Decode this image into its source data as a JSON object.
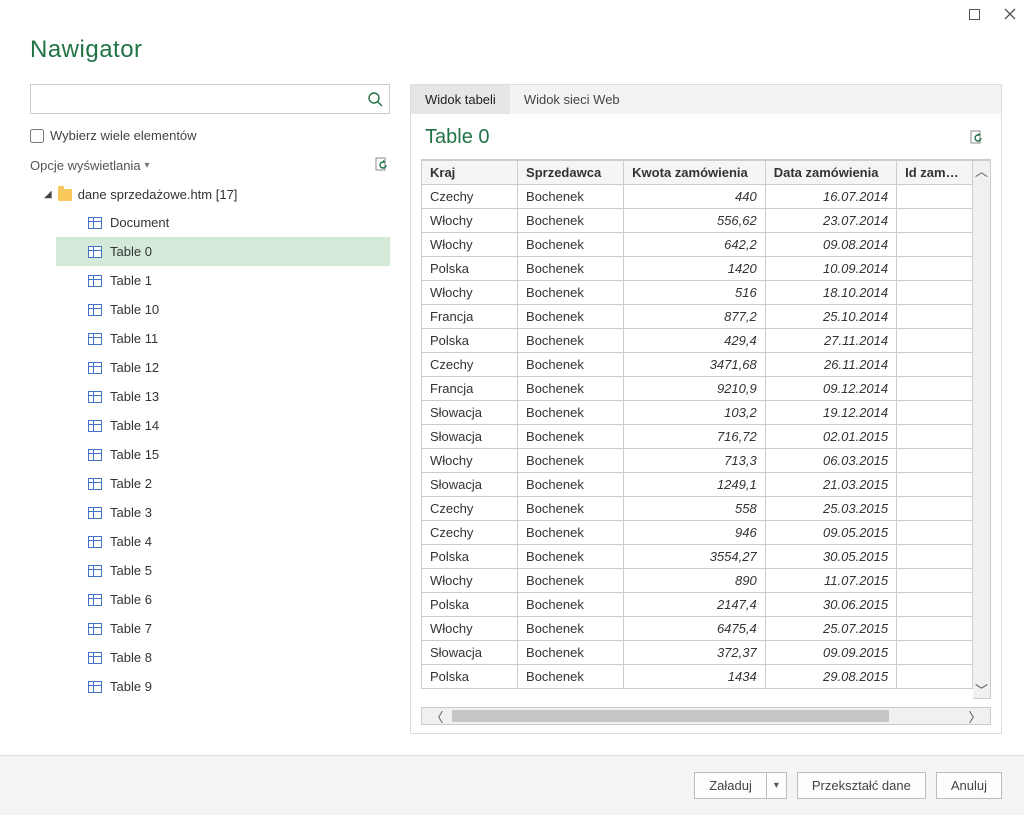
{
  "window": {
    "title": "Nawigator"
  },
  "left": {
    "search_placeholder": "",
    "multi_select_label": "Wybierz wiele elementów",
    "display_options_label": "Opcje wyświetlania",
    "root_label": "dane sprzedażowe.htm [17]",
    "items": [
      {
        "label": "Document",
        "selected": false
      },
      {
        "label": "Table 0",
        "selected": true
      },
      {
        "label": "Table 1",
        "selected": false
      },
      {
        "label": "Table 10",
        "selected": false
      },
      {
        "label": "Table 11",
        "selected": false
      },
      {
        "label": "Table 12",
        "selected": false
      },
      {
        "label": "Table 13",
        "selected": false
      },
      {
        "label": "Table 14",
        "selected": false
      },
      {
        "label": "Table 15",
        "selected": false
      },
      {
        "label": "Table 2",
        "selected": false
      },
      {
        "label": "Table 3",
        "selected": false
      },
      {
        "label": "Table 4",
        "selected": false
      },
      {
        "label": "Table 5",
        "selected": false
      },
      {
        "label": "Table 6",
        "selected": false
      },
      {
        "label": "Table 7",
        "selected": false
      },
      {
        "label": "Table 8",
        "selected": false
      },
      {
        "label": "Table 9",
        "selected": false
      }
    ]
  },
  "tabs": [
    {
      "label": "Widok tabeli",
      "active": true
    },
    {
      "label": "Widok sieci Web",
      "active": false
    }
  ],
  "preview": {
    "title": "Table 0",
    "columns": [
      "Kraj",
      "Sprzedawca",
      "Kwota zamówienia",
      "Data zamówienia",
      "Id zamówien"
    ],
    "rows": [
      {
        "kraj": "Czechy",
        "sprzedawca": "Bochenek",
        "kwota": "440",
        "data": "16.07.2014"
      },
      {
        "kraj": "Włochy",
        "sprzedawca": "Bochenek",
        "kwota": "556,62",
        "data": "23.07.2014"
      },
      {
        "kraj": "Włochy",
        "sprzedawca": "Bochenek",
        "kwota": "642,2",
        "data": "09.08.2014"
      },
      {
        "kraj": "Polska",
        "sprzedawca": "Bochenek",
        "kwota": "1420",
        "data": "10.09.2014"
      },
      {
        "kraj": "Włochy",
        "sprzedawca": "Bochenek",
        "kwota": "516",
        "data": "18.10.2014"
      },
      {
        "kraj": "Francja",
        "sprzedawca": "Bochenek",
        "kwota": "877,2",
        "data": "25.10.2014"
      },
      {
        "kraj": "Polska",
        "sprzedawca": "Bochenek",
        "kwota": "429,4",
        "data": "27.11.2014"
      },
      {
        "kraj": "Czechy",
        "sprzedawca": "Bochenek",
        "kwota": "3471,68",
        "data": "26.11.2014"
      },
      {
        "kraj": "Francja",
        "sprzedawca": "Bochenek",
        "kwota": "9210,9",
        "data": "09.12.2014"
      },
      {
        "kraj": "Słowacja",
        "sprzedawca": "Bochenek",
        "kwota": "103,2",
        "data": "19.12.2014"
      },
      {
        "kraj": "Słowacja",
        "sprzedawca": "Bochenek",
        "kwota": "716,72",
        "data": "02.01.2015"
      },
      {
        "kraj": "Włochy",
        "sprzedawca": "Bochenek",
        "kwota": "713,3",
        "data": "06.03.2015"
      },
      {
        "kraj": "Słowacja",
        "sprzedawca": "Bochenek",
        "kwota": "1249,1",
        "data": "21.03.2015"
      },
      {
        "kraj": "Czechy",
        "sprzedawca": "Bochenek",
        "kwota": "558",
        "data": "25.03.2015"
      },
      {
        "kraj": "Czechy",
        "sprzedawca": "Bochenek",
        "kwota": "946",
        "data": "09.05.2015"
      },
      {
        "kraj": "Polska",
        "sprzedawca": "Bochenek",
        "kwota": "3554,27",
        "data": "30.05.2015"
      },
      {
        "kraj": "Włochy",
        "sprzedawca": "Bochenek",
        "kwota": "890",
        "data": "11.07.2015"
      },
      {
        "kraj": "Polska",
        "sprzedawca": "Bochenek",
        "kwota": "2147,4",
        "data": "30.06.2015"
      },
      {
        "kraj": "Włochy",
        "sprzedawca": "Bochenek",
        "kwota": "6475,4",
        "data": "25.07.2015"
      },
      {
        "kraj": "Słowacja",
        "sprzedawca": "Bochenek",
        "kwota": "372,37",
        "data": "09.09.2015"
      },
      {
        "kraj": "Polska",
        "sprzedawca": "Bochenek",
        "kwota": "1434",
        "data": "29.08.2015"
      }
    ]
  },
  "footer": {
    "load_label": "Załaduj",
    "transform_label": "Przekształć dane",
    "cancel_label": "Anuluj"
  }
}
